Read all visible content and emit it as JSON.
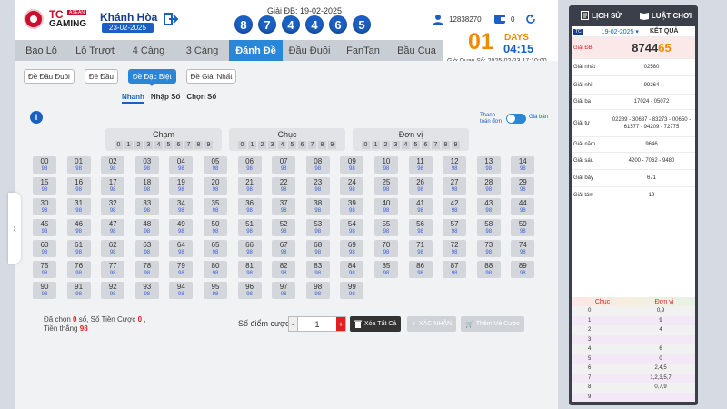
{
  "header": {
    "brand_tc": "TC",
    "brand_asean": "ASEAN",
    "brand_gaming": "GAMING",
    "province": "Khánh Hòa",
    "province_date": "23-02-2025",
    "db_title": "Giải ĐB: 19-02-2025",
    "db_balls": [
      "8",
      "7",
      "4",
      "4",
      "6",
      "5"
    ],
    "balance": "12838270",
    "cart_count": "0"
  },
  "game_tabs": [
    "Bao Lô",
    "Lô Trượt",
    "4 Càng",
    "3 Càng",
    "Đánh Đề",
    "Đầu Đuôi",
    "FanTan",
    "Bầu Cua"
  ],
  "active_game_tab": 4,
  "countdown": {
    "days_num": "01",
    "days_label": "DAYS",
    "time": "04:15",
    "draw_label": "Giờ Quay Số: 2025-02-23 17:10:00"
  },
  "sub_tabs": [
    "Đề Đầu Đuôi",
    "Đề Đầu",
    "Đề Đặc Biệt",
    "Đề Giải Nhất"
  ],
  "active_sub_tab": 2,
  "mode_tabs": [
    "Nhanh",
    "Nhập Số",
    "Chọn Số"
  ],
  "active_mode_tab": 0,
  "toggle": {
    "left_label": "Thanh toán đơn",
    "right_label": "Giá bán"
  },
  "digit_groups": [
    {
      "title": "Chạm",
      "digits": [
        "0",
        "1",
        "2",
        "3",
        "4",
        "5",
        "6",
        "7",
        "8",
        "9"
      ]
    },
    {
      "title": "Chục",
      "digits": [
        "0",
        "1",
        "2",
        "3",
        "4",
        "5",
        "6",
        "7",
        "8",
        "9"
      ]
    },
    {
      "title": "Đơn vị",
      "digits": [
        "0",
        "1",
        "2",
        "3",
        "4",
        "5",
        "6",
        "7",
        "8",
        "9"
      ]
    }
  ],
  "numbers": [
    "00",
    "01",
    "02",
    "03",
    "04",
    "05",
    "06",
    "07",
    "08",
    "09",
    "10",
    "11",
    "12",
    "13",
    "14",
    "15",
    "16",
    "17",
    "18",
    "19",
    "20",
    "21",
    "22",
    "23",
    "24",
    "25",
    "26",
    "27",
    "28",
    "29",
    "30",
    "31",
    "32",
    "33",
    "34",
    "35",
    "36",
    "37",
    "38",
    "39",
    "40",
    "41",
    "42",
    "43",
    "44",
    "45",
    "46",
    "47",
    "48",
    "49",
    "50",
    "51",
    "52",
    "53",
    "54",
    "55",
    "56",
    "57",
    "58",
    "59",
    "60",
    "61",
    "62",
    "63",
    "64",
    "65",
    "66",
    "67",
    "68",
    "69",
    "70",
    "71",
    "72",
    "73",
    "74",
    "75",
    "76",
    "77",
    "78",
    "79",
    "80",
    "81",
    "82",
    "83",
    "84",
    "85",
    "86",
    "87",
    "88",
    "89",
    "90",
    "91",
    "92",
    "93",
    "94",
    "95",
    "96",
    "97",
    "98",
    "99"
  ],
  "odds": "98",
  "summary": {
    "selected_label": "Đã chọn",
    "selected_value": "0",
    "selected_unit": "số,",
    "bet_label": "Số Tiền Cược",
    "bet_value": "0",
    "bet_sep": ",",
    "win_label": "Tiền thắng",
    "win_value": "98"
  },
  "bet": {
    "label": "Số điểm cược",
    "minus": "-",
    "value": "1",
    "plus": "+",
    "clear_label": "Xóa Tất Cả",
    "confirm_label": "XÁC NHẬN",
    "add_ticket_label": "Thêm Vé Cược"
  },
  "right_panel": {
    "history_label": "LỊCH SỬ",
    "rules_label": "LUẬT CHƠI",
    "badge": "TC",
    "date": "19-02-2025",
    "title": "KẾT QUẢ",
    "results": [
      {
        "label": "Giải ĐB",
        "value_main": "8744",
        "value_hl": "65"
      },
      {
        "label": "Giải nhất",
        "value": "02580"
      },
      {
        "label": "Giải nhì",
        "value": "99264"
      },
      {
        "label": "Giải ba",
        "value": "17024 - 05072"
      },
      {
        "label": "Giải tư",
        "value": "02289 - 30687 - 83273 - 00650 - 61577 - 94209 - 72775"
      },
      {
        "label": "Giải năm",
        "value": "9646"
      },
      {
        "label": "Giải sáu",
        "value": "4200 - 7062 - 9480"
      },
      {
        "label": "Giải bảy",
        "value": "671"
      },
      {
        "label": "Giải tám",
        "value": "19"
      }
    ],
    "stats_head": [
      "Chục",
      "Đơn vị"
    ],
    "stats": [
      {
        "k": "0",
        "v": "0,9"
      },
      {
        "k": "1",
        "v": "9"
      },
      {
        "k": "2",
        "v": "4"
      },
      {
        "k": "3",
        "v": ""
      },
      {
        "k": "4",
        "v": "6"
      },
      {
        "k": "5",
        "v": "0"
      },
      {
        "k": "6",
        "v": "2,4,5"
      },
      {
        "k": "7",
        "v": "1,2,3,5,7"
      },
      {
        "k": "8",
        "v": "0,7,9"
      },
      {
        "k": "9",
        "v": ""
      }
    ]
  },
  "colors": {
    "primary": "#2a87d8",
    "dark_blue": "#1b5fc2",
    "orange": "#f08a00",
    "red": "#e02020"
  }
}
